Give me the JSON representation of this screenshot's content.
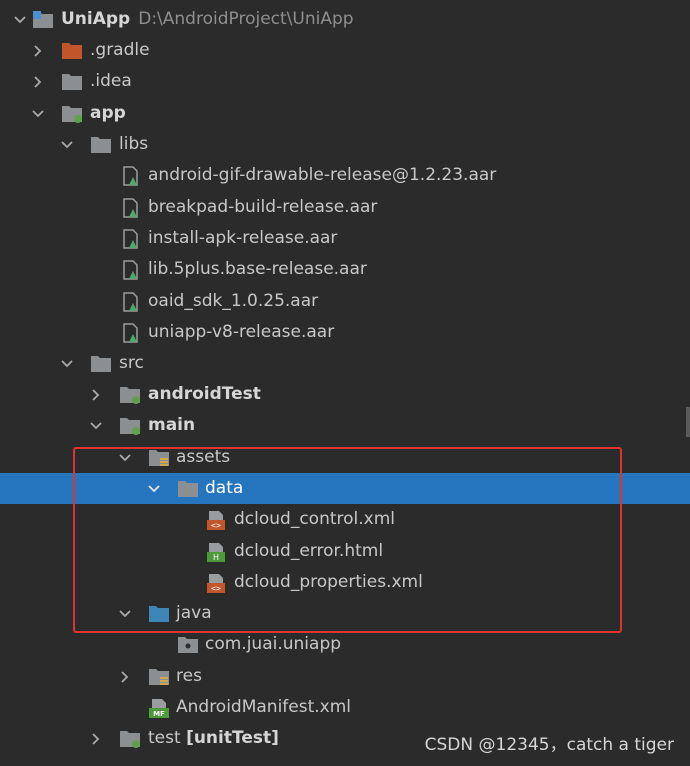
{
  "tree": {
    "root": {
      "name": "UniApp",
      "path": "D:\\AndroidProject\\UniApp"
    },
    "items": [
      {
        "label": "UniApp",
        "path": "D:\\AndroidProject\\UniApp"
      },
      {
        "label": ".gradle"
      },
      {
        "label": ".idea"
      },
      {
        "label": "app"
      },
      {
        "label": "libs"
      },
      {
        "label": "android-gif-drawable-release@1.2.23.aar"
      },
      {
        "label": "breakpad-build-release.aar"
      },
      {
        "label": "install-apk-release.aar"
      },
      {
        "label": "lib.5plus.base-release.aar"
      },
      {
        "label": "oaid_sdk_1.0.25.aar"
      },
      {
        "label": "uniapp-v8-release.aar"
      },
      {
        "label": "src"
      },
      {
        "label": "androidTest"
      },
      {
        "label": "main"
      },
      {
        "label": "assets"
      },
      {
        "label": "data"
      },
      {
        "label": "dcloud_control.xml"
      },
      {
        "label": "dcloud_error.html"
      },
      {
        "label": "dcloud_properties.xml"
      },
      {
        "label": "java"
      },
      {
        "label": "com.juai.uniapp"
      },
      {
        "label": "res"
      },
      {
        "label": "AndroidManifest.xml"
      },
      {
        "label": "test",
        "suffix": "[unitTest]"
      }
    ]
  },
  "icons": {
    "folder": "folder-icon",
    "module": "module-folder-icon",
    "aar": "aar-library-icon",
    "xml": "xml-file-icon",
    "html": "html-file-icon",
    "manifest": "manifest-file-icon",
    "package": "package-icon"
  },
  "colors": {
    "background": "#2b2b2b",
    "selection": "#2675bf",
    "highlight_border": "#e0322e"
  },
  "watermark": "CSDN @12345，catch a tiger"
}
